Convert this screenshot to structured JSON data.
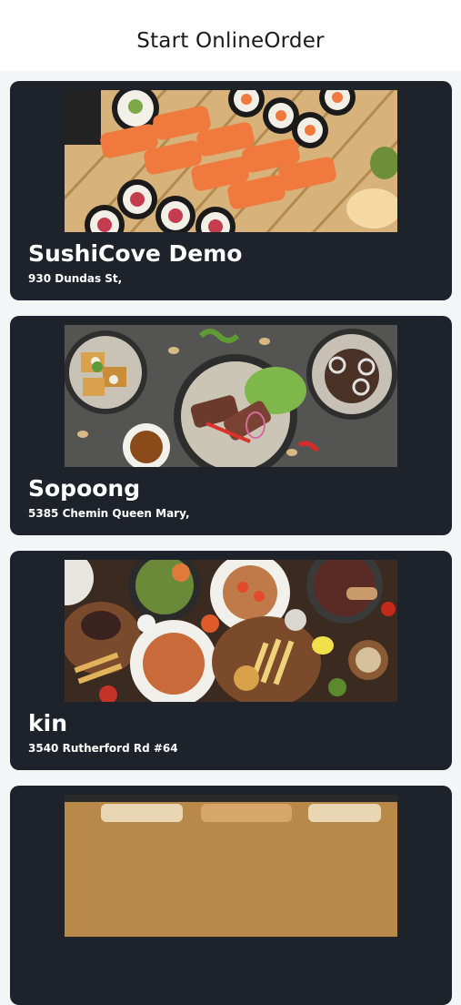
{
  "header": {
    "title": "Start OnlineOrder"
  },
  "restaurants": [
    {
      "name": "SushiCove Demo",
      "address": "930 Dundas St,",
      "image": "sushi-platter"
    },
    {
      "name": "Sopoong",
      "address": "5385 Chemin Queen Mary,",
      "image": "korean-dishes"
    },
    {
      "name": "kin",
      "address": "3540 Rutherford Rd #64",
      "image": "feast-spread"
    },
    {
      "name": "",
      "address": "",
      "image": "wood-tray"
    }
  ]
}
